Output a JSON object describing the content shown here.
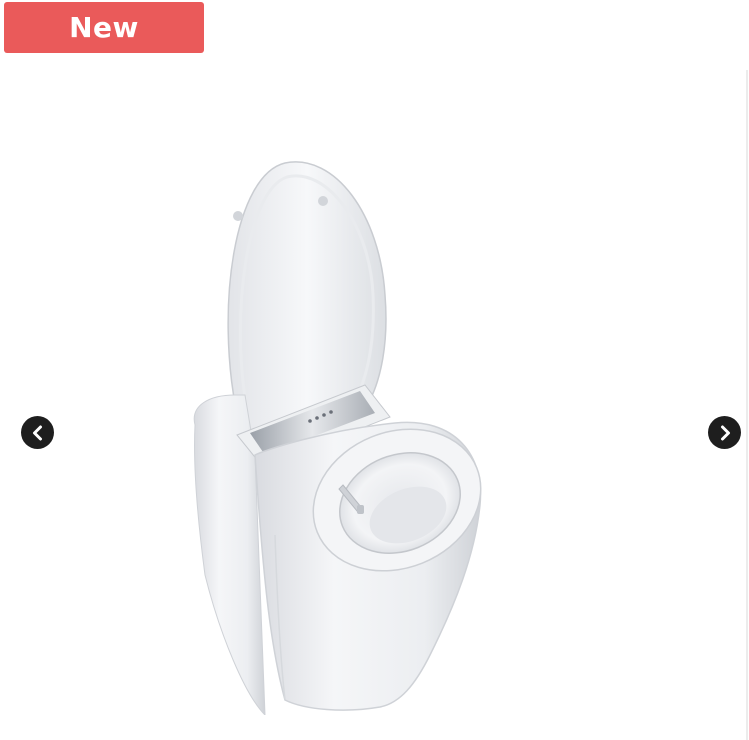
{
  "badge": {
    "label": "New",
    "color": "#ea5a5a"
  },
  "product_image": {
    "alt": "",
    "subject": "toilet-image"
  },
  "navigation": {
    "prev_icon": "chevron-left-icon",
    "next_icon": "chevron-right-icon"
  }
}
